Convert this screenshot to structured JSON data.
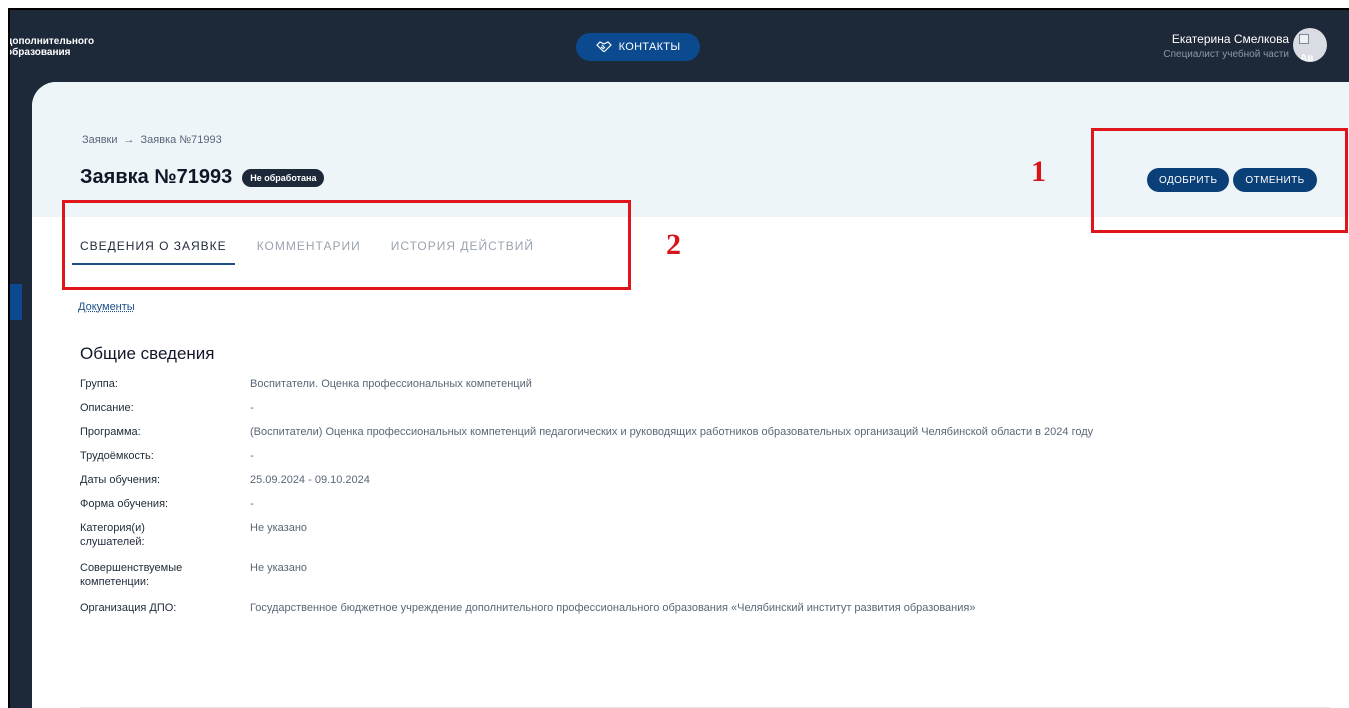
{
  "header": {
    "logo_line1": "дополнительного",
    "logo_line2": "образования",
    "contacts_label": "КОНТАКТЫ",
    "user_name": "Екатерина Смелкова",
    "user_role": "Специалист учебной части",
    "avatar_alt": "Ав"
  },
  "breadcrumb": {
    "root": "Заявки",
    "arrow": "→",
    "current": "Заявка №71993"
  },
  "page": {
    "title": "Заявка №71993",
    "status": "Не обработана",
    "approve_label": "ОДОБРИТЬ",
    "cancel_label": "ОТМЕНИТЬ"
  },
  "tabs": [
    {
      "label": "СВЕДЕНИЯ О ЗАЯВКЕ",
      "active": true
    },
    {
      "label": "КОММЕНТАРИИ",
      "active": false
    },
    {
      "label": "ИСТОРИЯ ДЕЙСТВИЙ",
      "active": false
    }
  ],
  "documents_link": "Документы",
  "section_title": "Общие сведения",
  "info": [
    {
      "label": "Группа:",
      "value": "Воспитатели. Оценка профессиональных компетенций"
    },
    {
      "label": "Описание:",
      "value": "-"
    },
    {
      "label": "Программа:",
      "value": "(Воспитатели) Оценка профессиональных компетенций педагогических и руководящих работников образовательных организаций Челябинской области в 2024 году"
    },
    {
      "label": "Трудоёмкость:",
      "value": "-"
    },
    {
      "label": "Даты обучения:",
      "value": "25.09.2024 - 09.10.2024"
    },
    {
      "label": "Форма обучения:",
      "value": "-"
    },
    {
      "label": "Категория(и) слушателей:",
      "value": "Не указано"
    },
    {
      "label": "Совершенствуемые компетенции:",
      "value": "Не указано"
    },
    {
      "label": "Организация ДПО:",
      "value": "Государственное бюджетное учреждение дополнительного профессионального образования «Челябинский институт развития образования»"
    }
  ],
  "annotations": {
    "one": "1",
    "two": "2"
  },
  "colors": {
    "topbar": "#1d2939",
    "primary_button": "#0b3f78",
    "header_band": "#eef5f8",
    "annotation": "#e0141b"
  }
}
